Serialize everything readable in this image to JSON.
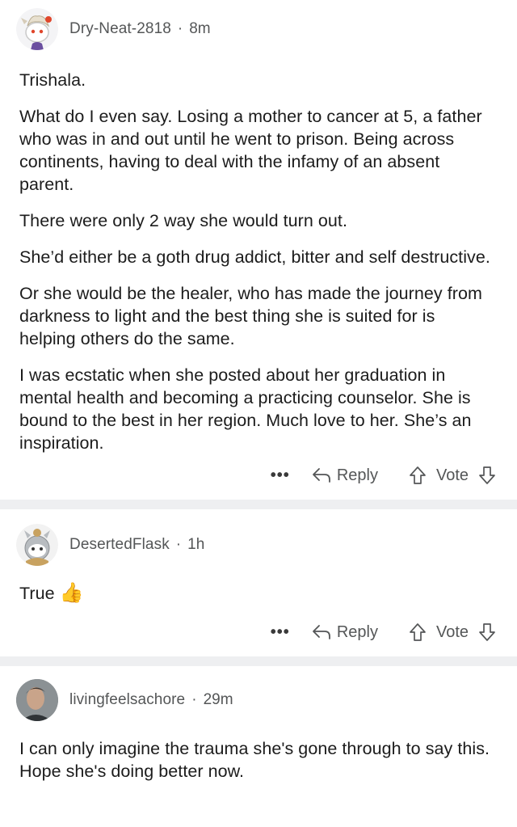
{
  "comments": [
    {
      "author": "Dry-Neat-2818",
      "time": "8m",
      "paragraphs": [
        "Trishala.",
        "What do I even say. Losing a mother to cancer at 5, a father who was in and out until he went to prison. Being across continents, having to deal with the infamy of an absent parent.",
        "There were only 2 way she would turn out.",
        "She’d either be a goth drug addict, bitter and self destructive.",
        "Or she would be the healer, who has made the journey from darkness to light and the best thing she is suited for is helping others do the same.",
        "I was ecstatic when she posted about her graduation in mental health and becoming a practicing counselor. She is bound to the best in her region. Much love to her. She’s an inspiration."
      ],
      "more": "•••",
      "reply": "Reply",
      "vote": "Vote"
    },
    {
      "author": "DesertedFlask",
      "time": "1h",
      "text": "True",
      "emoji": "👍",
      "more": "•••",
      "reply": "Reply",
      "vote": "Vote"
    },
    {
      "author": "livingfeelsachore",
      "time": "29m",
      "text": "I can only imagine the trauma she's gone through to say this. Hope she's doing better now."
    }
  ],
  "separator": "·",
  "icons": {
    "reply": "reply-arrow-icon",
    "upvote": "upvote-arrow-icon",
    "downvote": "downvote-arrow-icon",
    "more": "more-options-icon"
  }
}
